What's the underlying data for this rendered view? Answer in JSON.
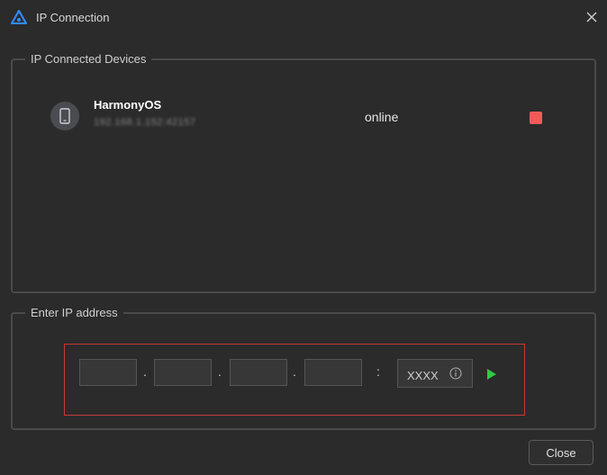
{
  "window": {
    "title": "IP Connection"
  },
  "devices_group": {
    "legend": "IP Connected Devices",
    "devices": [
      {
        "name": "HarmonyOS",
        "id": "192.168.1.152:42157",
        "status": "online"
      }
    ]
  },
  "ip_group": {
    "legend": "Enter IP address",
    "octets": [
      "",
      "",
      "",
      ""
    ],
    "separator_dot": ".",
    "separator_colon": ":",
    "port_placeholder": "XXXX"
  },
  "footer": {
    "close_label": "Close"
  },
  "colors": {
    "stop_red": "#f25a5a",
    "play_green": "#2ecc40",
    "highlight_border": "#c53a3a",
    "logo_blue": "#2f8cff"
  },
  "icons": [
    "app-logo-icon",
    "close-icon",
    "phone-icon",
    "stop-icon",
    "info-icon",
    "play-icon"
  ]
}
